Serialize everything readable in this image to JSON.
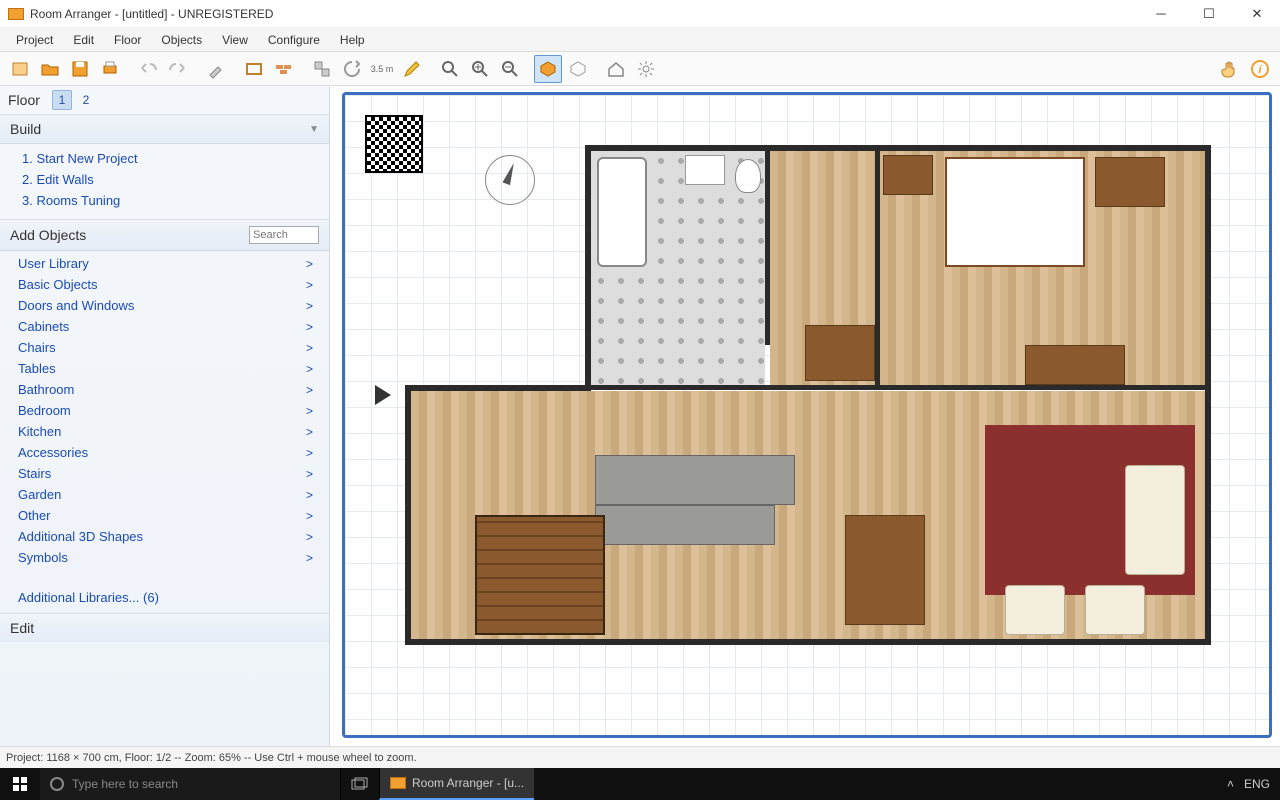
{
  "window": {
    "title": "Room Arranger - [untitled] - UNREGISTERED"
  },
  "menu": [
    "Project",
    "Edit",
    "Floor",
    "Objects",
    "View",
    "Configure",
    "Help"
  ],
  "toolbar": {
    "measure_label": "3.5 m"
  },
  "sidebar": {
    "floor_label": "Floor",
    "floors": [
      "1",
      "2"
    ],
    "active_floor": 0,
    "build_header": "Build",
    "build_items": [
      "1. Start New Project",
      "2. Edit Walls",
      "3. Rooms Tuning"
    ],
    "add_objects_header": "Add Objects",
    "search_placeholder": "Search",
    "categories": [
      "User Library",
      "Basic Objects",
      "Doors and Windows",
      "Cabinets",
      "Chairs",
      "Tables",
      "Bathroom",
      "Bedroom",
      "Kitchen",
      "Accessories",
      "Stairs",
      "Garden",
      "Other",
      "Additional 3D Shapes",
      "Symbols"
    ],
    "additional_libraries": "Additional Libraries... (6)",
    "edit_header": "Edit"
  },
  "status": {
    "text": "Project: 1168 × 700 cm, Floor: 1/2 -- Zoom: 65% -- Use Ctrl + mouse wheel to zoom."
  },
  "taskbar": {
    "search_placeholder": "Type here to search",
    "app_label": "Room Arranger - [u...",
    "lang": "ENG"
  }
}
